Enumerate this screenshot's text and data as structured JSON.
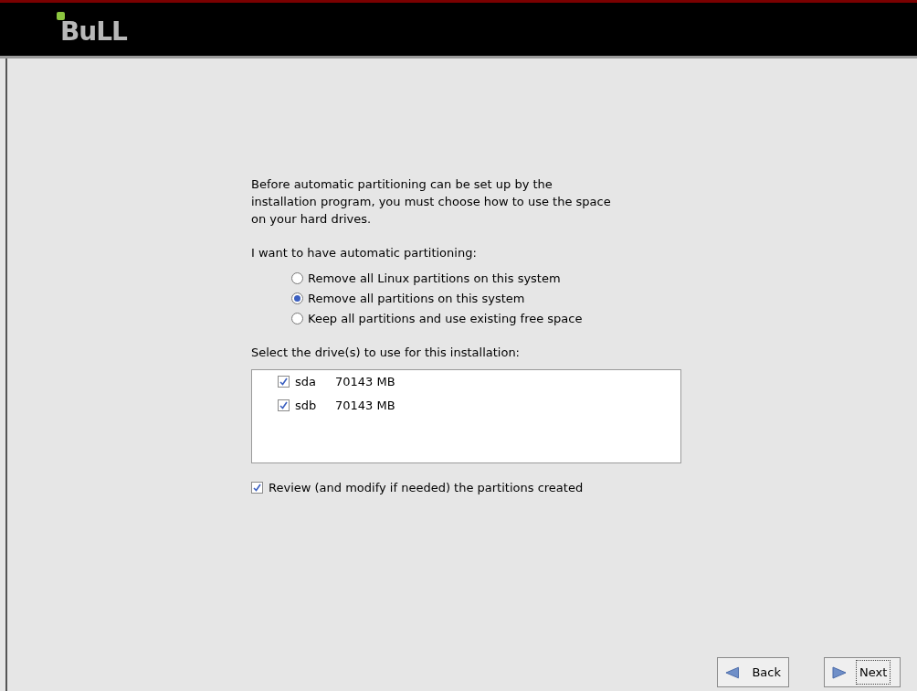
{
  "header": {
    "logo": "BuLL"
  },
  "intro": "Before automatic partitioning can be set up by the installation program, you must choose how to use the space on your hard drives.",
  "partitioning": {
    "label": "I want to have automatic partitioning:",
    "options": [
      {
        "label": "Remove all Linux partitions on this system",
        "selected": false
      },
      {
        "label": "Remove all partitions on this system",
        "selected": true
      },
      {
        "label": "Keep all partitions and use existing free space",
        "selected": false
      }
    ]
  },
  "drives": {
    "label": "Select the drive(s) to use for this installation:",
    "items": [
      {
        "name": "sda",
        "size": "70143 MB",
        "checked": true
      },
      {
        "name": "sdb",
        "size": "70143 MB",
        "checked": true
      }
    ]
  },
  "review": {
    "label": "Review (and modify if needed) the partitions created",
    "checked": true
  },
  "buttons": [
    {
      "kind": "back",
      "label": "Back",
      "focused": false
    },
    {
      "kind": "next",
      "label": "Next",
      "focused": true
    }
  ]
}
